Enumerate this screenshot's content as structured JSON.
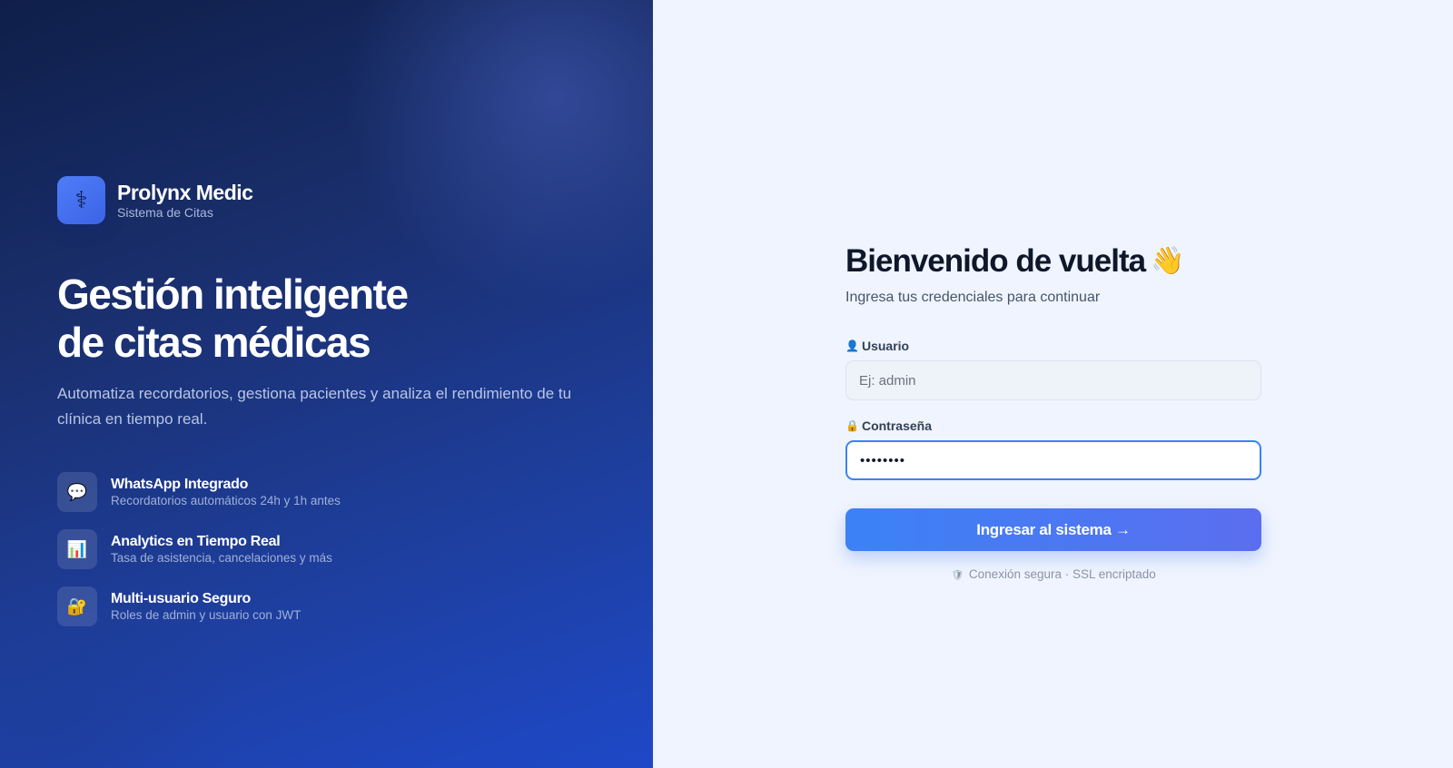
{
  "brand": {
    "name": "Prolynx Medic",
    "subtitle": "Sistema de Citas",
    "logo_icon": "caduceus-icon",
    "logo_glyph": "⚕"
  },
  "hero": {
    "title_line1": "Gestión inteligente",
    "title_line2": "de citas médicas",
    "description": "Automatiza recordatorios, gestiona pacientes y analiza el rendimiento de tu clínica en tiempo real."
  },
  "features": [
    {
      "icon": "speech-bubble-icon",
      "glyph": "💬",
      "title": "WhatsApp Integrado",
      "subtitle": "Recordatorios automáticos 24h y 1h antes"
    },
    {
      "icon": "bar-chart-icon",
      "glyph": "📊",
      "title": "Analytics en Tiempo Real",
      "subtitle": "Tasa de asistencia, cancelaciones y más"
    },
    {
      "icon": "lock-key-icon",
      "glyph": "🔐",
      "title": "Multi-usuario Seguro",
      "subtitle": "Roles de admin y usuario con JWT"
    }
  ],
  "login": {
    "title": "Bienvenido de vuelta",
    "title_emoji": "👋",
    "subtitle": "Ingresa tus credenciales para continuar",
    "username_label": "Usuario",
    "username_icon": "👤",
    "username_placeholder": "Ej: admin",
    "username_value": "",
    "password_label": "Contraseña",
    "password_icon": "🔒",
    "password_value": "password",
    "submit_label": "Ingresar al sistema →",
    "secure_icon": "🛡",
    "secure_text": "Conexión segura · SSL encriptado"
  },
  "colors": {
    "accent": "#3b82f6",
    "accent_end": "#5b6ef0",
    "panel_dark": "#0f1f4a",
    "panel_light": "#1e48c8",
    "background": "#eff4fe"
  }
}
